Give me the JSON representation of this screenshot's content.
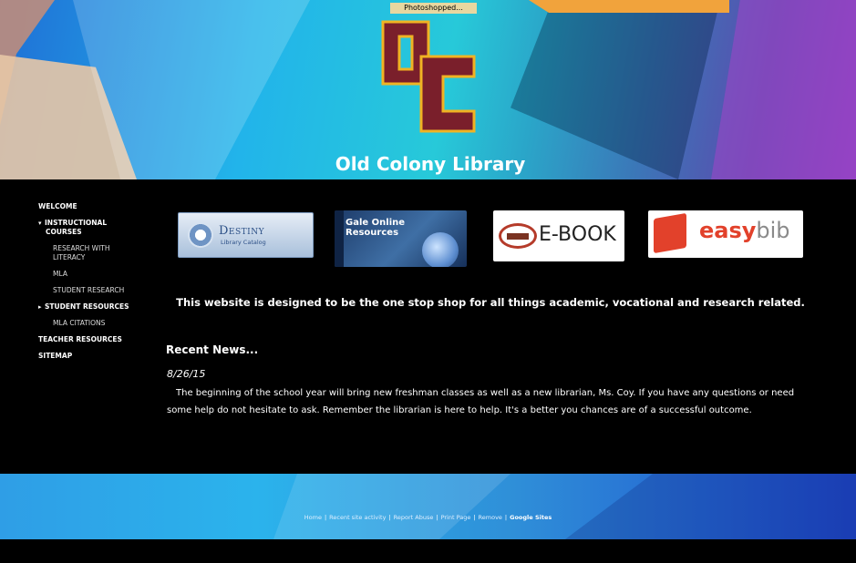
{
  "header": {
    "logo_caption": "Photoshopped...",
    "site_title": "Old Colony Library",
    "colors": {
      "maroon": "#7a1f2b",
      "gold": "#f0b323"
    }
  },
  "nav": {
    "items": [
      {
        "label": "WELCOME",
        "bullet": ""
      },
      {
        "label": "INSTRUCTIONAL COURSES",
        "bullet": "▾"
      },
      {
        "label": "RESEARCH WITH LITERACY",
        "bullet": "",
        "sub": true
      },
      {
        "label": "MLA",
        "bullet": "",
        "sub": true
      },
      {
        "label": "STUDENT RESEARCH",
        "bullet": "",
        "sub": true
      },
      {
        "label": "STUDENT RESOURCES",
        "bullet": "▸"
      },
      {
        "label": "MLA CITATIONS",
        "bullet": "",
        "sub": true
      },
      {
        "label": "TEACHER RESOURCES",
        "bullet": ""
      },
      {
        "label": "SITEMAP",
        "bullet": ""
      }
    ]
  },
  "resources": {
    "destiny": {
      "title": "Destiny",
      "subtitle": "Library Catalog"
    },
    "gale": {
      "title": "Gale Online Resources"
    },
    "ebook": {
      "text": "E-BOOK"
    },
    "easybib": {
      "easy": "easy",
      "bib": "bib"
    }
  },
  "main": {
    "tagline": "This website is designed to be the one stop shop for all things academic, vocational and research related.",
    "news_heading": "Recent News...",
    "news_date": "8/26/15",
    "news_body": "The beginning of the school year will bring new freshman classes as well as a new librarian, Ms. Coy. If you have any questions or need some help do not hesitate to ask. Remember the librarian is here to help. It's a better you chances are of a successful outcome."
  },
  "footer": {
    "links": [
      "Home",
      "Recent site activity",
      "Report Abuse",
      "Print Page",
      "Remove"
    ],
    "powered_by": "Google Sites"
  }
}
